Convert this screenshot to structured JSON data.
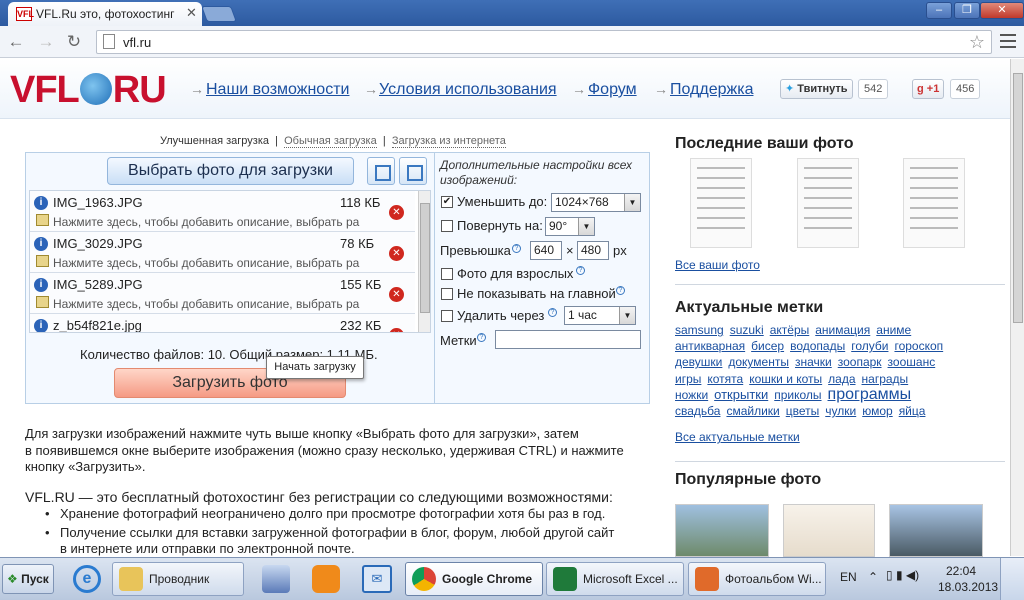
{
  "browser": {
    "tab_title": "VFL.Ru это, фотохостинг бе",
    "tab_favicon": "VFL",
    "url": "vfl.ru",
    "window_controls": [
      "–",
      "❐",
      "✕"
    ]
  },
  "site": {
    "logo_left": "VFL",
    "logo_right": "RU",
    "nav": [
      "Наши возможности",
      "Условия использования",
      "Форум",
      "Поддержка"
    ],
    "tweet_label": "Твитнуть",
    "tweet_count": "542",
    "gplus_label": "+1",
    "gplus_count": "456"
  },
  "upload": {
    "modes": {
      "improved": "Улучшенная загрузка",
      "regular": "Обычная загрузка",
      "internet": "Загрузка из интернета",
      "sep": "|"
    },
    "choose_button": "Выбрать фото для загрузки",
    "files": [
      {
        "name": "IMG_1963.JPG",
        "size": "118 КБ",
        "desc": "Нажмите здесь, чтобы добавить описание, выбрать ра"
      },
      {
        "name": "IMG_3029.JPG",
        "size": "78 КБ",
        "desc": "Нажмите здесь, чтобы добавить описание, выбрать ра"
      },
      {
        "name": "IMG_5289.JPG",
        "size": "155 КБ",
        "desc": "Нажмите здесь, чтобы добавить описание, выбрать ра"
      },
      {
        "name": "z_b54f821e.jpg",
        "size": "232 КБ",
        "desc": ""
      }
    ],
    "summary": "Количество файлов: 10. Общий размер: 1,11 МБ.",
    "upload_button": "Загрузить фото",
    "tooltip": "Начать загрузку"
  },
  "settings": {
    "heading": "Дополнительные настройки всех изображений:",
    "reduce_label": "Уменьшить до:",
    "reduce_checked": true,
    "reduce_value": "1024×768",
    "rotate_label": "Повернуть на:",
    "rotate_value": "90°",
    "preview_label": "Превьюшка",
    "preview_w": "640",
    "preview_x": "×",
    "preview_h": "480",
    "preview_unit": "px",
    "adult_label": "Фото для взрослых",
    "hide_label": "Не показывать на главной",
    "delete_label": "Удалить через",
    "delete_value": "1 час",
    "tags_label": "Метки"
  },
  "text": {
    "p1_l1": "Для загрузки изображений нажмите чуть выше кнопку «Выбрать фото для загрузки», затем",
    "p1_l2": "в появившемся окне выберите изображения (можно сразу несколько, удерживая CTRL) и нажмите",
    "p1_l3": "кнопку «Загрузить».",
    "p2": "VFL.RU — это бесплатный фотохостинг без регистрации со следующими возможностями:",
    "b1": "Хранение фотографий неограничено долго при просмотре фотографии хотя бы раз в год.",
    "b2_l1": "Получение ссылки для вставки загруженной фотографии в блог, форум, любой другой сайт",
    "b2_l2": "в интернете или отправки по электронной почте."
  },
  "right": {
    "recent_title": "Последние ваши фото",
    "all_photos": "Все ваши фото",
    "tags_title": "Актуальные метки",
    "tags": [
      "samsung",
      "suzuki",
      "актёры",
      "анимация",
      "аниме",
      "антикварная",
      "бисер",
      "водопады",
      "голуби",
      "гороскоп",
      "девушки",
      "документы",
      "значки",
      "зоопарк",
      "зоошанс",
      "игры",
      "котята",
      "кошки и коты",
      "лада",
      "награды",
      "ножки",
      "открытки",
      "приколы",
      "программы",
      "свадьба",
      "смайлики",
      "цветы",
      "чулки",
      "юмор",
      "яйца"
    ],
    "all_tags": "Все актуальные метки",
    "popular_title": "Популярные фото"
  },
  "taskbar": {
    "start": "Пуск",
    "items": [
      "Проводник",
      "Google Chrome",
      "Microsoft Excel ...",
      "Фотоальбом Wi..."
    ],
    "lang": "EN",
    "time": "22:04",
    "date": "18.03.2013"
  },
  "colors": {
    "brand_red": "#c8102e",
    "link_blue": "#1a4fa0",
    "upload_orange": "#f59a84"
  }
}
